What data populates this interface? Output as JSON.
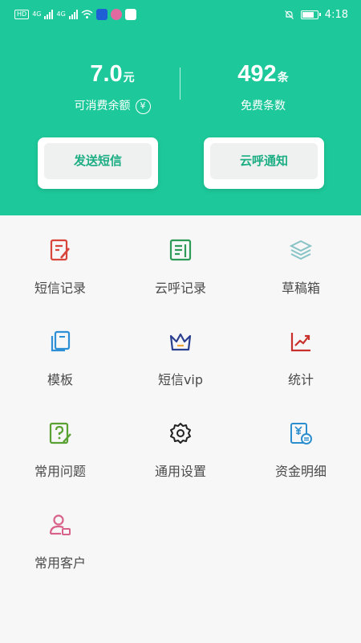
{
  "status_bar": {
    "left_chip": "HD",
    "net_1": "4G",
    "net_2": "4G",
    "time": "4:18",
    "battery_level": 0.85
  },
  "balance": {
    "amount": "7.0",
    "amount_unit": "元",
    "amount_label": "可消费余额",
    "free_count": "492",
    "free_unit": "条",
    "free_label": "免费条数",
    "recharge_glyph": "¥"
  },
  "actions": {
    "send_sms": "发送短信",
    "cloud_notify": "云呼通知"
  },
  "menu": [
    {
      "label": "短信记录",
      "icon": "sms-record-icon",
      "color": "#d8453a"
    },
    {
      "label": "云呼记录",
      "icon": "call-record-icon",
      "color": "#2e9a57"
    },
    {
      "label": "草稿箱",
      "icon": "drafts-layers-icon",
      "color": "#88c3c6"
    },
    {
      "label": "模板",
      "icon": "template-icon",
      "color": "#2d8fd6"
    },
    {
      "label": "短信vip",
      "icon": "crown-icon",
      "color": "#2a3f8f"
    },
    {
      "label": "统计",
      "icon": "chart-trend-icon",
      "color": "#c9302c"
    },
    {
      "label": "常用问题",
      "icon": "question-icon",
      "color": "#58a132"
    },
    {
      "label": "通用设置",
      "icon": "gear-icon",
      "color": "#222222"
    },
    {
      "label": "资金明细",
      "icon": "fund-detail-icon",
      "color": "#2b8ecf"
    },
    {
      "label": "常用客户",
      "icon": "customer-icon",
      "color": "#d9628a"
    }
  ]
}
